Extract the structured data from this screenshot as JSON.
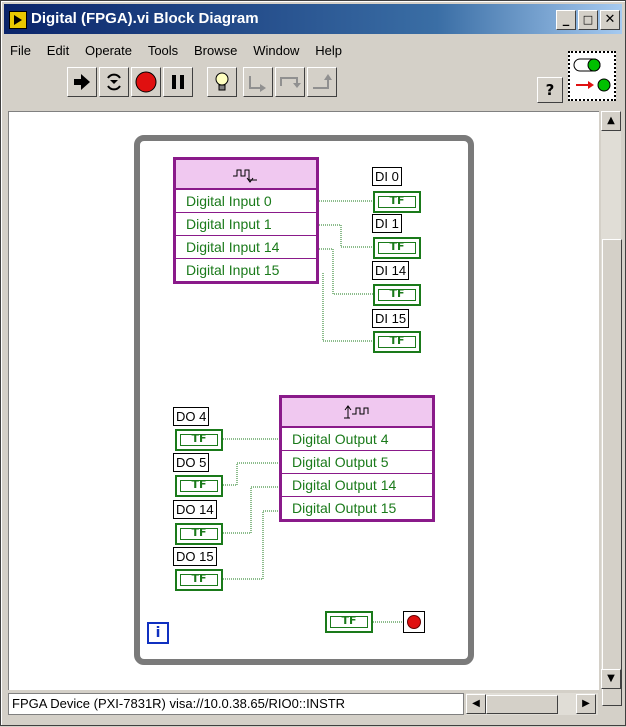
{
  "window": {
    "title": "Digital (FPGA).vi Block Diagram",
    "controls": [
      "_",
      "□",
      "✕"
    ]
  },
  "menu": [
    "File",
    "Edit",
    "Operate",
    "Tools",
    "Browse",
    "Window",
    "Help"
  ],
  "toolbar": {
    "help_label": "?"
  },
  "diagram": {
    "input_node": {
      "icon": "digital-input-icon",
      "rows": [
        "Digital Input 0",
        "Digital Input 1",
        "Digital Input 14",
        "Digital Input 15"
      ]
    },
    "indicators": [
      "DI 0",
      "DI 1",
      "DI 14",
      "DI 15"
    ],
    "output_node": {
      "icon": "digital-output-icon",
      "rows": [
        "Digital Output 4",
        "Digital Output 5",
        "Digital Output 14",
        "Digital Output 15"
      ]
    },
    "controls": [
      "DO 4",
      "DO 5",
      "DO 14",
      "DO 15"
    ],
    "tf_label": "TF",
    "iteration_label": "i"
  },
  "statusbar": {
    "text": "FPGA Device (PXI-7831R) visa://10.0.38.65/RIO0::INSTR"
  }
}
